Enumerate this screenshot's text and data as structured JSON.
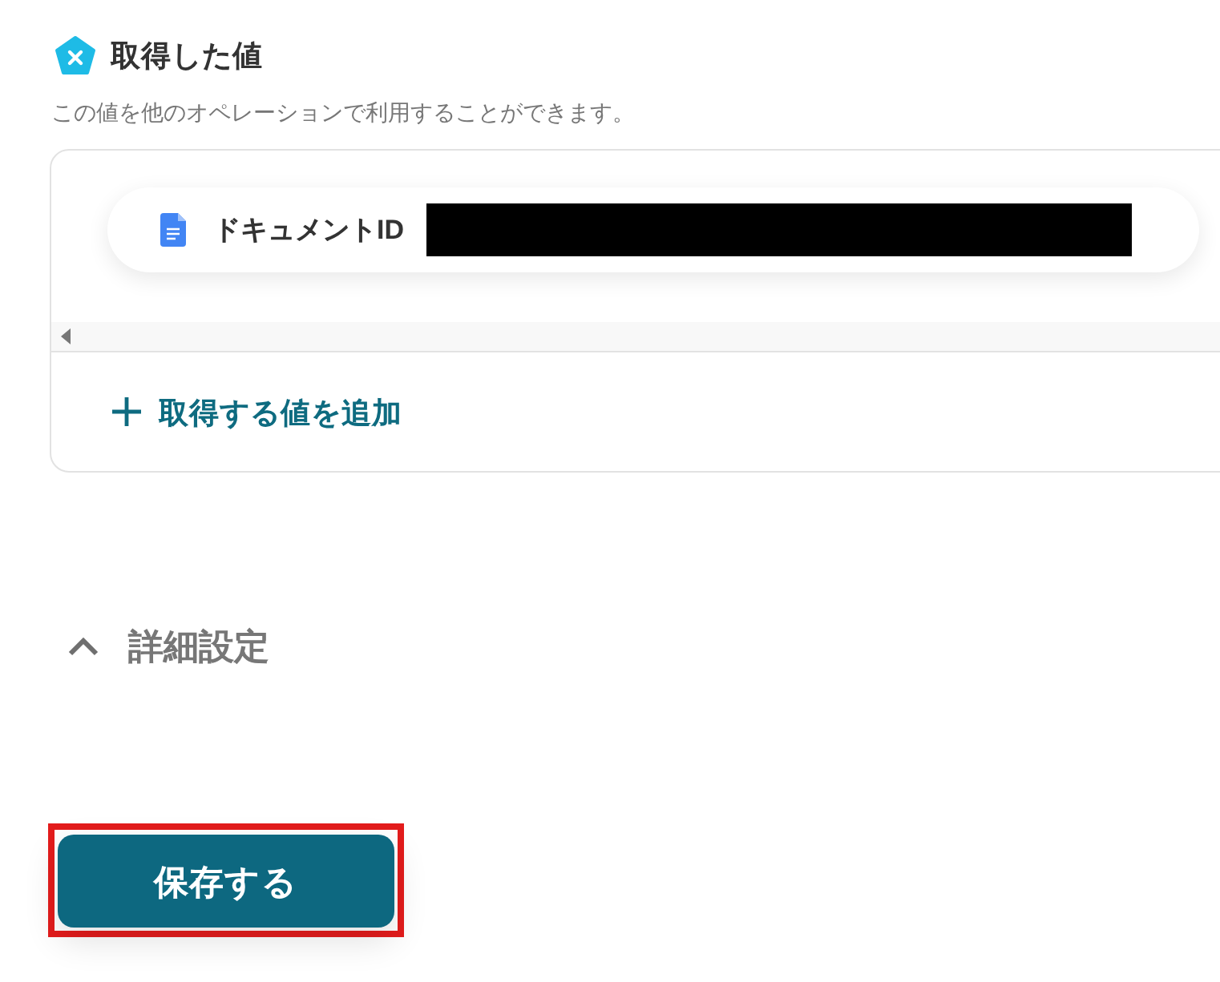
{
  "section": {
    "title": "取得した値",
    "description": "この値を他のオペレーションで利用することができます。"
  },
  "values": [
    {
      "label": "ドキュメントID",
      "redacted": true
    }
  ],
  "add_button": {
    "label": "取得する値を追加"
  },
  "advanced": {
    "label": "詳細設定",
    "expanded": true
  },
  "save_button": {
    "label": "保存する",
    "highlighted": true
  }
}
